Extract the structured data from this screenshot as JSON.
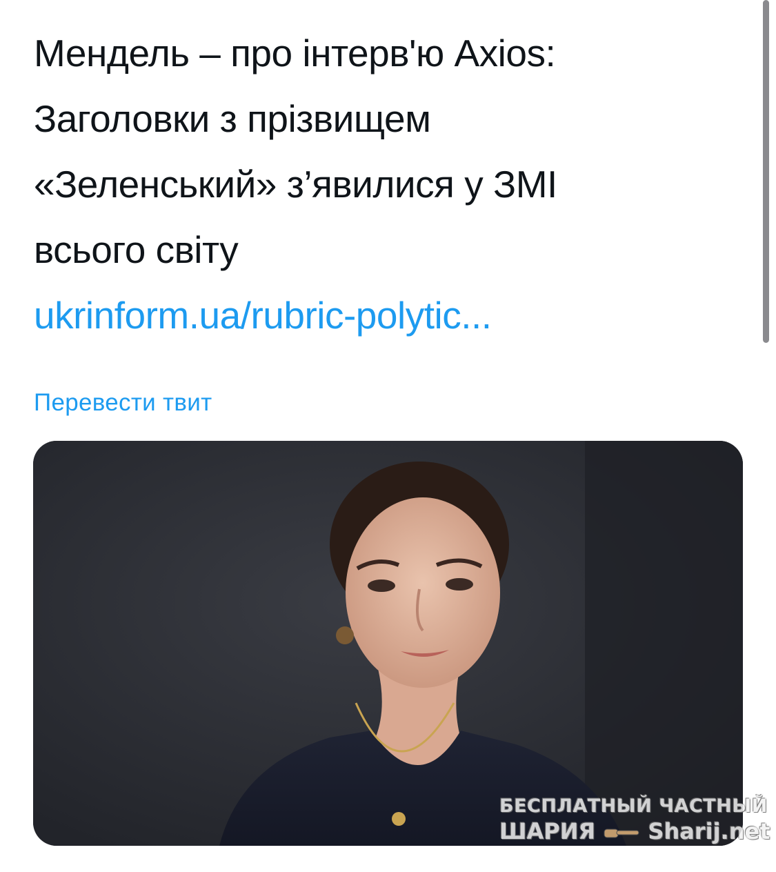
{
  "tweet": {
    "text_lines": [
      "Мендель – про інтерв'ю Axios:",
      "Заголовки з прізвищем",
      "«Зеленський» з’явилися у ЗМІ",
      "всього світу"
    ],
    "link_text": "ukrinform.ua/rubric-polytic...",
    "translate_label": "Перевести твит"
  },
  "watermark": {
    "top_line": "БЕСПЛАТНЫЙ ЧАСТНЫЙ",
    "bottom_left": "ШАРИЯ",
    "bottom_right": "Sharij.net"
  },
  "colors": {
    "text": "#0f1419",
    "link": "#1d9bf0",
    "photo_background": "#2b2d33"
  }
}
